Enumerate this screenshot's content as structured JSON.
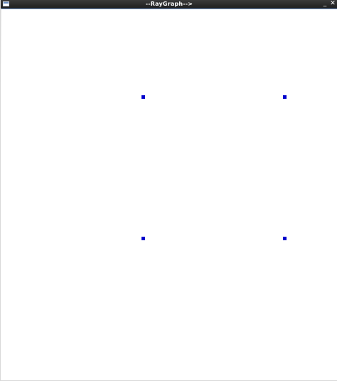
{
  "window": {
    "title": "--RayGraph-->",
    "minimize_glyph": "_",
    "close_glyph": "✕",
    "icon": "window-icon"
  },
  "graph": {
    "node_color": "#0000cc",
    "background": "#ffffff",
    "nodes": [
      {
        "id": "node-1"
      },
      {
        "id": "node-2"
      },
      {
        "id": "node-3"
      },
      {
        "id": "node-4"
      }
    ]
  }
}
